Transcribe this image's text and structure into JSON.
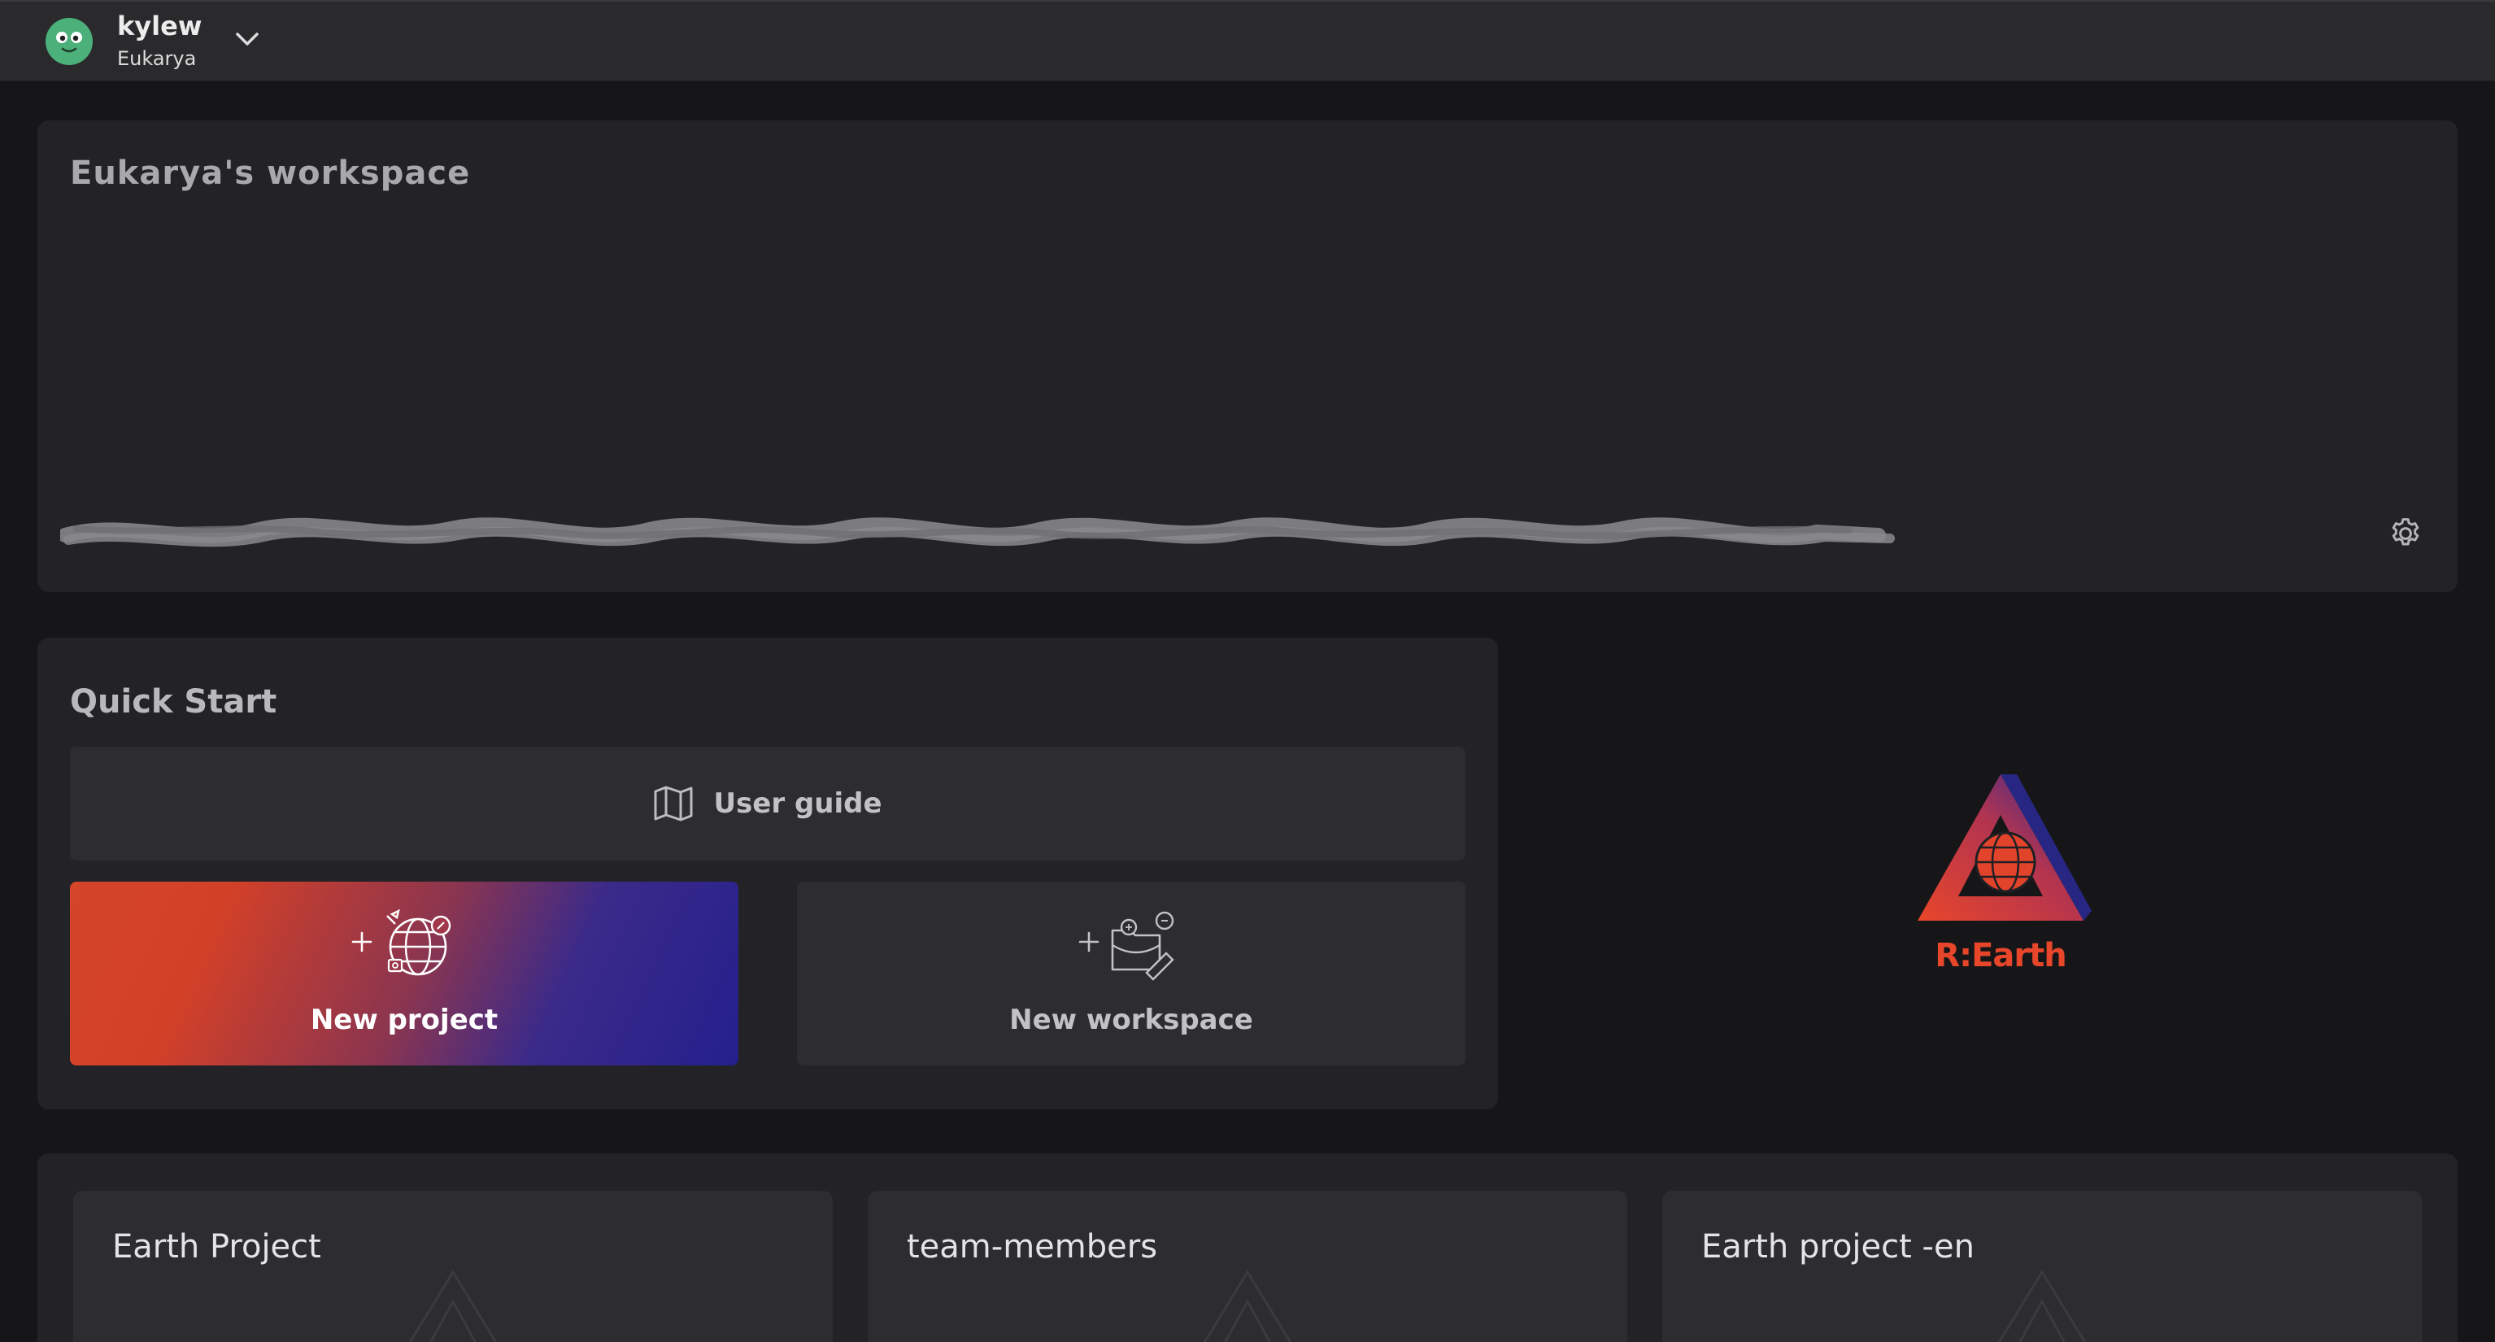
{
  "header": {
    "user_name": "kylew",
    "workspace_name": "Eukarya"
  },
  "workspace": {
    "title": "Eukarya's workspace"
  },
  "quick_start": {
    "title": "Quick Start",
    "user_guide_label": "User guide",
    "new_project_label": "New project",
    "new_workspace_label": "New workspace"
  },
  "logo": {
    "text": "R:Earth"
  },
  "projects": [
    {
      "title": "Earth Project"
    },
    {
      "title": "team-members"
    },
    {
      "title": "Earth project -en"
    }
  ],
  "colors": {
    "accent": "#e8462a",
    "gradient_start": "#d4452a",
    "gradient_end": "#25208c",
    "background": "#161618",
    "card": "#232327"
  }
}
